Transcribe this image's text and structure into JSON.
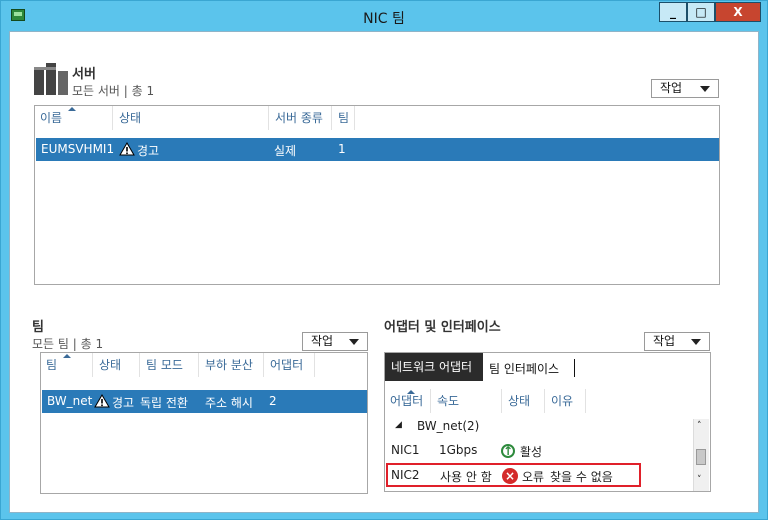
{
  "window": {
    "title": "NIC 팀"
  },
  "window_buttons": {
    "minimize": "_",
    "maximize": "□",
    "close": "X"
  },
  "servers": {
    "title": "서버",
    "subtitle": "모든 서버 | 총 1",
    "task_label": "작업",
    "columns": [
      "이름",
      "상태",
      "서버 종류",
      "팀"
    ],
    "rows": [
      {
        "name": "EUMSVHMI1",
        "status": "경고",
        "type": "실제",
        "teams": "1"
      }
    ]
  },
  "teams": {
    "title": "팀",
    "subtitle": "모든 팀 | 총 1",
    "task_label": "작업",
    "columns": [
      "팀",
      "상태",
      "팀 모드",
      "부하 분산",
      "어댑터"
    ],
    "rows": [
      {
        "team": "BW_net",
        "status": "경고",
        "mode": "독립 전환",
        "balancing": "주소 해시",
        "adapters": "2"
      }
    ]
  },
  "adapters": {
    "title": "어댑터 및 인터페이스",
    "task_label": "작업",
    "tabs": [
      "네트워크 어댑터",
      "팀 인터페이스"
    ],
    "columns": [
      "어댑터",
      "속도",
      "상태",
      "이유"
    ],
    "group": {
      "label": "BW_net(2)"
    },
    "rows": [
      {
        "adapter": "NIC1",
        "speed": "1Gbps",
        "state": "활성",
        "reason": ""
      },
      {
        "adapter": "NIC2",
        "speed": "사용 안 함",
        "state": "오류",
        "reason": "찾을 수 없음"
      }
    ],
    "highlight_color": "#e0202a"
  },
  "colors": {
    "selection": "#2a7ab8",
    "titlebar": "#5bc4ec",
    "close": "#c7452f"
  },
  "icons": {
    "app": "nic-team-icon",
    "server": "server-icon",
    "warning": "warning-icon",
    "ok": "up-arrow-circle-icon",
    "error": "error-x-icon"
  }
}
